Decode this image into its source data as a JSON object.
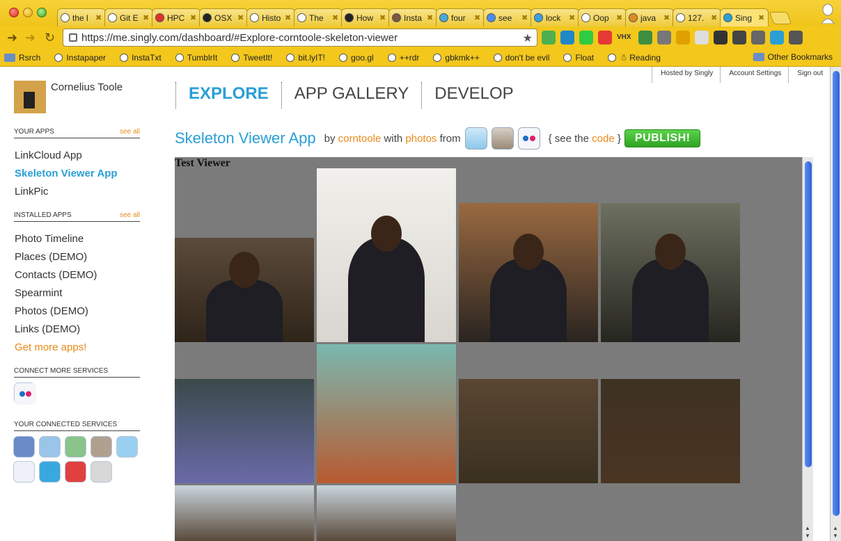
{
  "browser": {
    "tabs": [
      {
        "label": "the l",
        "fav_color": "#ffffff"
      },
      {
        "label": "Git E",
        "fav_color": "#ffffff"
      },
      {
        "label": "HPC",
        "fav_color": "#e0302a"
      },
      {
        "label": "OSX",
        "fav_color": "#222222"
      },
      {
        "label": "Histo",
        "fav_color": "#ffffff"
      },
      {
        "label": "The",
        "fav_color": "#ffffff"
      },
      {
        "label": "How",
        "fav_color": "#222222"
      },
      {
        "label": "Insta",
        "fav_color": "#7a5a40"
      },
      {
        "label": "four",
        "fav_color": "#4aa9d6"
      },
      {
        "label": "see",
        "fav_color": "#4a8af4"
      },
      {
        "label": "lock",
        "fav_color": "#3aa0e0"
      },
      {
        "label": "Oop",
        "fav_color": "#ffffff"
      },
      {
        "label": "java",
        "fav_color": "#e08a20"
      },
      {
        "label": "127.",
        "fav_color": "#ffffff"
      },
      {
        "label": "Sing",
        "fav_color": "#2a9fd6",
        "active": true
      }
    ],
    "url": "https://me.singly.com/dashboard/#Explore-corntoole-skeleton-viewer",
    "bookmarks": [
      "Rsrch",
      "Instapaper",
      "InstaTxt",
      "TumblrIt",
      "TweetIt!",
      "bit.lyIT!",
      "goo.gl",
      "++rdr",
      "gbkmk++",
      "don't be evil",
      "Float",
      "☃ Reading"
    ],
    "other_bookmarks": "Other Bookmarks",
    "ext_colors": [
      "#4caf50",
      "#1e88c8",
      "#2ecc40",
      "#e53935",
      "#555555",
      "#3e8e41",
      "#777777",
      "#e0a000",
      "#dddddd",
      "#333333",
      "#444444",
      "#666666",
      "#2a9fd6",
      "#555555"
    ],
    "ext_vhx": "VHX"
  },
  "topnav": {
    "hosted": "Hosted by Singly",
    "account": "Account Settings",
    "signout": "Sign out"
  },
  "user": {
    "name": "Cornelius Toole"
  },
  "sidebar": {
    "your_apps": {
      "title": "YOUR APPS",
      "see_all": "see all",
      "items": [
        "LinkCloud App",
        "Skeleton Viewer App",
        "LinkPic"
      ]
    },
    "installed_apps": {
      "title": "INSTALLED APPS",
      "see_all": "see all",
      "items": [
        "Photo Timeline",
        "Places (DEMO)",
        "Contacts (DEMO)",
        "Spearmint",
        "Photos (DEMO)",
        "Links (DEMO)"
      ],
      "more": "Get more apps!"
    },
    "connect_more": {
      "title": "CONNECT MORE SERVICES"
    },
    "connected": {
      "title": "YOUR CONNECTED SERVICES"
    }
  },
  "mainnav": {
    "explore": "EXPLORE",
    "gallery": "APP GALLERY",
    "develop": "DEVELOP"
  },
  "app": {
    "title": "Skeleton Viewer App",
    "by": "by",
    "author": "corntoole",
    "with": "with",
    "photos": "photos",
    "from": "from",
    "see_the": "{ see the",
    "code": "code",
    "close_brace": "}",
    "publish": "PUBLISH!"
  },
  "viewer": {
    "title": "Test Viewer",
    "photos": [
      {
        "name": "photo-selfie-beanie",
        "top": "#5b4b3b",
        "bottom": "#2e2418"
      },
      {
        "name": "photo-suit-white-backdrop",
        "top": "#f2f0ec",
        "bottom": "#d9d6d0"
      },
      {
        "name": "photo-suit-arms-crossed",
        "top": "#9a6a40",
        "bottom": "#2a2420"
      },
      {
        "name": "photo-suit-dark-backdrop",
        "top": "#6e7060",
        "bottom": "#262620"
      },
      {
        "name": "photo-girl-with-baby",
        "top": "#3a4a4a",
        "bottom": "#6a6aa8"
      },
      {
        "name": "photo-bedroom",
        "top": "#7ab8b0",
        "bottom": "#b85a30"
      },
      {
        "name": "photo-wood-pile-1",
        "top": "#5a4632",
        "bottom": "#3a3020"
      },
      {
        "name": "photo-wood-pile-2",
        "top": "#3e3222",
        "bottom": "#4a3422"
      },
      {
        "name": "photo-forest-1",
        "top": "#c8d4dc",
        "bottom": "#5a4a3a"
      },
      {
        "name": "photo-forest-2",
        "top": "#c8d4dc",
        "bottom": "#5a4a3a"
      }
    ]
  },
  "services": {
    "connect_more": [
      {
        "name": "flickr-icon",
        "color": "#f4f6fa"
      }
    ],
    "connected": [
      {
        "name": "facebook-icon",
        "color": "#6a8ac8"
      },
      {
        "name": "foursquare-icon",
        "color": "#9ac4e8"
      },
      {
        "name": "google-contacts-icon",
        "color": "#8ac48a"
      },
      {
        "name": "instagram-icon",
        "color": "#b0a090"
      },
      {
        "name": "twitter-icon",
        "color": "#9ad0f0"
      },
      {
        "name": "posterous-icon",
        "color": "#eef2f8"
      },
      {
        "name": "tumblr-icon",
        "color": "#3aa8e0"
      },
      {
        "name": "lastfm-icon",
        "color": "#e04040"
      },
      {
        "name": "gowalla-icon",
        "color": "#d8d8d8"
      }
    ]
  }
}
